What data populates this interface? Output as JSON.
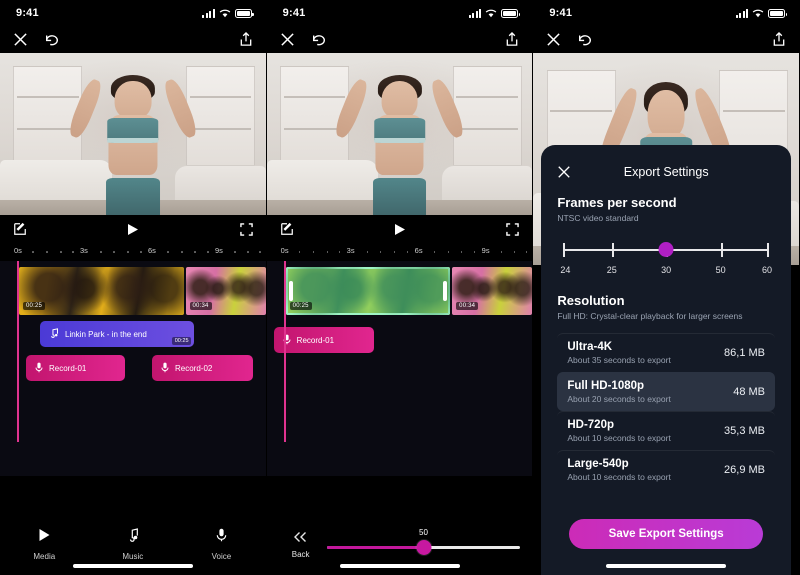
{
  "status_bar": {
    "time": "9:41",
    "signal_icon": "signal-bars-icon",
    "wifi_icon": "wifi-icon",
    "battery_icon": "battery-icon"
  },
  "toolbar": {
    "close_icon": "close-icon",
    "undo_icon": "undo-icon",
    "share_icon": "share-export-icon"
  },
  "editor_bar": {
    "edit_icon": "edit-pencil-icon",
    "play_icon": "play-icon",
    "fullscreen_icon": "fullscreen-icon"
  },
  "ruler": {
    "labels": [
      "0s",
      "3s",
      "6s",
      "9s"
    ]
  },
  "timeline": {
    "clips": [
      {
        "name": "clip-1",
        "duration": "00:25"
      },
      {
        "name": "clip-2",
        "duration": "00:34"
      }
    ],
    "music": {
      "icon": "music-note-icon",
      "label": "Linkin Park - in the end",
      "duration": "00:25"
    },
    "recordings": [
      {
        "icon": "mic-icon",
        "label": "Record-01"
      },
      {
        "icon": "mic-icon",
        "label": "Record-02"
      }
    ]
  },
  "tabbar": {
    "items": [
      {
        "icon": "play-icon",
        "label": "Media"
      },
      {
        "icon": "music-note-icon",
        "label": "Music"
      },
      {
        "icon": "mic-icon",
        "label": "Voice"
      }
    ]
  },
  "panel2": {
    "selected_recording": {
      "icon": "mic-icon",
      "label": "Record-01"
    },
    "back": {
      "icon": "chevron-double-left-icon",
      "label": "Back"
    },
    "slider": {
      "value": "50",
      "percent": 50,
      "fill_color": "#c3189c"
    }
  },
  "export_sheet": {
    "close_icon": "close-icon",
    "title": "Export Settings",
    "fps": {
      "heading": "Frames per second",
      "subtitle": "NTSC video standard",
      "options": [
        "24",
        "25",
        "30",
        "50",
        "60"
      ],
      "selected": "30",
      "thumb_color": "#b01fc4"
    },
    "resolution": {
      "heading": "Resolution",
      "subtitle": "Full HD: Crystal-clear playback for larger screens",
      "options": [
        {
          "name": "Ultra-4K",
          "time": "About 35 seconds to export",
          "size": "86,1 MB",
          "selected": false
        },
        {
          "name": "Full HD-1080p",
          "time": "About 20 seconds to export",
          "size": "48 MB",
          "selected": true
        },
        {
          "name": "HD-720p",
          "time": "About 10 seconds to export",
          "size": "35,3 MB",
          "selected": false
        },
        {
          "name": "Large-540p",
          "time": "About 10 seconds to export",
          "size": "26,9 MB",
          "selected": false
        }
      ]
    },
    "save_button": "Save Export Settings"
  }
}
